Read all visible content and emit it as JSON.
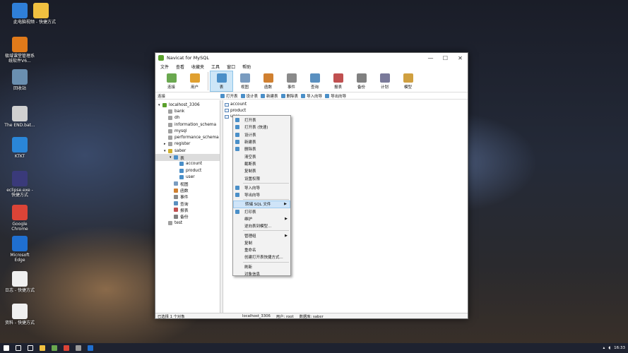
{
  "desktop": {
    "icons": [
      {
        "label": "此电脑",
        "icon": "computer-icon",
        "color": "#2f7fd8"
      },
      {
        "label": "极域课堂管理系统软件V6...",
        "icon": "classroom-icon",
        "color": "#e07a1a"
      },
      {
        "label": "回收站",
        "icon": "recycle-bin-icon",
        "color": "#6a8fb0"
      },
      {
        "label": "The END.bat...",
        "icon": "bat-file-icon",
        "color": "#d0d0d0"
      },
      {
        "label": "KTKT",
        "icon": "bird-icon",
        "color": "#2a86d8"
      },
      {
        "label": "eclipse.exe - 快捷方式",
        "icon": "eclipse-icon",
        "color": "#3a3a7a"
      },
      {
        "label": "Google Chrome",
        "icon": "chrome-icon",
        "color": "#db4437"
      },
      {
        "label": "Microsoft Edge",
        "icon": "edge-icon",
        "color": "#1f6fd0"
      },
      {
        "label": "日志 - 快捷方式",
        "icon": "document-icon",
        "color": "#f0f0f0"
      },
      {
        "label": "资料 - 快捷方式",
        "icon": "document-icon",
        "color": "#f0f0f0"
      },
      {
        "label": "视频 - 快捷方式",
        "icon": "folder-icon",
        "color": "#f0c040"
      }
    ]
  },
  "window": {
    "title": "Navicat for MySQL",
    "controls": {
      "minimize": "—",
      "maximize": "☐",
      "close": "✕"
    },
    "menu": [
      "文件",
      "查看",
      "收藏夹",
      "工具",
      "窗口",
      "帮助"
    ],
    "toolbar": [
      {
        "label": "连接",
        "icon": "connection-icon",
        "color": "#6aa84f"
      },
      {
        "label": "用户",
        "icon": "user-icon",
        "color": "#e0a030"
      },
      {
        "label": "表",
        "icon": "table-icon",
        "color": "#4a8fc8",
        "active": true
      },
      {
        "label": "视图",
        "icon": "view-icon",
        "color": "#7a9cc0"
      },
      {
        "label": "函数",
        "icon": "function-icon",
        "color": "#d08030"
      },
      {
        "label": "事件",
        "icon": "event-icon",
        "color": "#8a8a8a"
      },
      {
        "label": "查询",
        "icon": "query-icon",
        "color": "#5a90c0"
      },
      {
        "label": "报表",
        "icon": "report-icon",
        "color": "#c05050"
      },
      {
        "label": "备份",
        "icon": "backup-icon",
        "color": "#808080"
      },
      {
        "label": "计划",
        "icon": "schedule-icon",
        "color": "#7a7a9a"
      },
      {
        "label": "模型",
        "icon": "model-icon",
        "color": "#d0a040"
      }
    ],
    "subbar": {
      "left": "连接",
      "actions": [
        "打开表",
        "设计表",
        "新建表",
        "删除表",
        "导入向导",
        "导出向导"
      ]
    },
    "tree": [
      {
        "label": "localhost_3306",
        "level": 0,
        "icon": "server-icon",
        "expanded": true
      },
      {
        "label": "bank",
        "level": 1,
        "icon": "database-icon"
      },
      {
        "label": "dh",
        "level": 1,
        "icon": "database-icon"
      },
      {
        "label": "information_schema",
        "level": 1,
        "icon": "database-icon"
      },
      {
        "label": "mysql",
        "level": 1,
        "icon": "database-icon"
      },
      {
        "label": "performance_schema",
        "level": 1,
        "icon": "database-icon"
      },
      {
        "label": "register",
        "level": 1,
        "icon": "database-icon",
        "collapsed": true
      },
      {
        "label": "saber",
        "level": 1,
        "icon": "database-open-icon",
        "expanded": true
      },
      {
        "label": "表",
        "level": 2,
        "icon": "table-icon",
        "expanded": true,
        "selected": true
      },
      {
        "label": "account",
        "level": 3,
        "icon": "table-icon"
      },
      {
        "label": "product",
        "level": 3,
        "icon": "table-icon"
      },
      {
        "label": "user",
        "level": 3,
        "icon": "table-icon"
      },
      {
        "label": "视图",
        "level": 2,
        "icon": "view-icon"
      },
      {
        "label": "函数",
        "level": 2,
        "icon": "function-icon"
      },
      {
        "label": "事件",
        "level": 2,
        "icon": "event-icon"
      },
      {
        "label": "查询",
        "level": 2,
        "icon": "query-icon"
      },
      {
        "label": "报表",
        "level": 2,
        "icon": "report-icon"
      },
      {
        "label": "备份",
        "level": 2,
        "icon": "backup-icon"
      },
      {
        "label": "test",
        "level": 1,
        "icon": "database-icon"
      }
    ],
    "objects": [
      "account",
      "product",
      "user"
    ],
    "status": {
      "selected": "已选择 1 个对象",
      "connection": "localhost_3306",
      "user": "用户: root",
      "database": "数据库: saber"
    }
  },
  "context_menu": [
    {
      "label": "打开表",
      "icon": true
    },
    {
      "label": "打开表 (快速)",
      "icon": true
    },
    {
      "label": "设计表",
      "icon": true
    },
    {
      "label": "新建表",
      "icon": true
    },
    {
      "label": "删除表",
      "icon": true
    },
    {
      "label": "清空表"
    },
    {
      "label": "截断表"
    },
    {
      "label": "复制表"
    },
    {
      "label": "设置权限"
    },
    {
      "sep": true
    },
    {
      "label": "导入向导",
      "icon": true
    },
    {
      "label": "导出向导",
      "icon": true
    },
    {
      "sep": true
    },
    {
      "label": "转储 SQL 文件",
      "highlight": true,
      "submenu": true
    },
    {
      "label": "打印表",
      "icon": true
    },
    {
      "label": "维护",
      "submenu": true
    },
    {
      "label": "逆向表到模型..."
    },
    {
      "sep": true
    },
    {
      "label": "管理组",
      "submenu": true
    },
    {
      "label": "复制"
    },
    {
      "label": "重命名"
    },
    {
      "label": "创建打开表快捷方式..."
    },
    {
      "sep": true
    },
    {
      "label": "刷新"
    },
    {
      "label": "对象信息"
    }
  ],
  "taskbar": {
    "items": [
      {
        "icon": "windows-start-icon",
        "color": "#ffffff"
      },
      {
        "icon": "search-icon",
        "color": "#ffffff"
      },
      {
        "icon": "task-view-icon",
        "color": "#ffffff"
      },
      {
        "icon": "file-explorer-icon",
        "color": "#f0c040"
      },
      {
        "icon": "navicat-icon",
        "color": "#6aa84f"
      },
      {
        "icon": "chrome-icon",
        "color": "#db4437"
      },
      {
        "icon": "app-icon",
        "color": "#9a9a9a"
      },
      {
        "icon": "edge-icon",
        "color": "#1f6fd0"
      }
    ],
    "time": "16:33"
  }
}
